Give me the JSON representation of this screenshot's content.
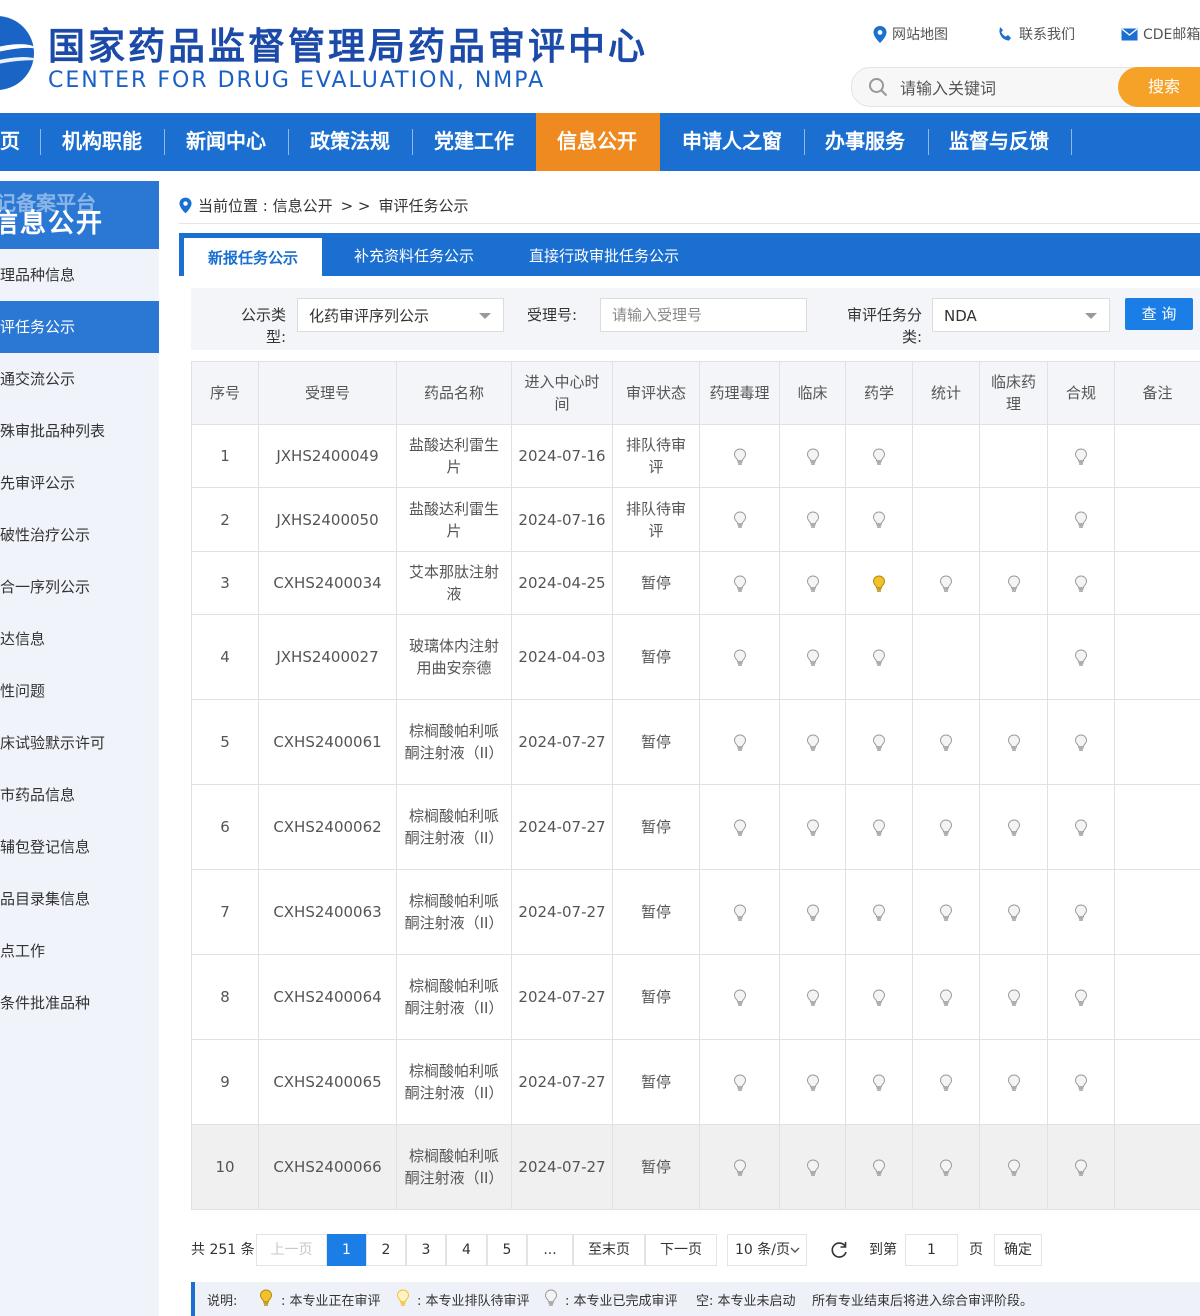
{
  "header": {
    "title_cn": "国家药品监督管理局药品审评中心",
    "title_en": "CENTER FOR DRUG EVALUATION, NMPA",
    "links": [
      "网站地图",
      "联系我们",
      "CDE邮箱"
    ],
    "search_placeholder": "请输入关键词",
    "search_button": "搜索"
  },
  "nav": {
    "items": [
      "页",
      "机构职能",
      "新闻中心",
      "政策法规",
      "党建工作",
      "信息公开",
      "申请人之窗",
      "办事服务",
      "监督与反馈"
    ],
    "active": "信息公开"
  },
  "sidebar": {
    "ghost_title": "记备案平台",
    "title": "信息公开",
    "items": [
      "理品种信息",
      "评任务公示",
      "通交流公示",
      "殊审批品种列表",
      "先审评公示",
      "破性治疗公示",
      "合一序列公示",
      "达信息",
      "性问题",
      "床试验默示许可",
      "市药品信息",
      "辅包登记信息",
      "品目录集信息",
      "点工作",
      "条件批准品种"
    ],
    "active_index": 1
  },
  "breadcrumb": {
    "prefix": "当前位置 : 信息公开",
    "sep": "> >",
    "current": "审评任务公示"
  },
  "tabs": [
    "新报任务公示",
    "补充资料任务公示",
    "直接行政审批任务公示"
  ],
  "filters": {
    "type_label_1": "公示类",
    "type_label_2": "型:",
    "type_value": "化药审评序列公示",
    "accept_label": "受理号:",
    "accept_placeholder": "请输入受理号",
    "task_label_1": "审评任务分",
    "task_label_2": "类:",
    "task_value": "NDA",
    "query_button": "查 询"
  },
  "table": {
    "headers": [
      "序号",
      "受理号",
      "药品名称",
      "进入中心时间",
      "审评状态",
      "药理毒理",
      "临床",
      "药学",
      "统计",
      "临床药理",
      "合规",
      "备注"
    ],
    "rows": [
      {
        "no": "1",
        "id": "JXHS2400049",
        "name": "盐酸达利雷生片",
        "date": "2024-07-16",
        "status": "排队待审评",
        "lamps": [
          "off",
          "off",
          "off",
          "",
          "",
          "off"
        ]
      },
      {
        "no": "2",
        "id": "JXHS2400050",
        "name": "盐酸达利雷生片",
        "date": "2024-07-16",
        "status": "排队待审评",
        "lamps": [
          "off",
          "off",
          "off",
          "",
          "",
          "off"
        ]
      },
      {
        "no": "3",
        "id": "CXHS2400034",
        "name": "艾本那肽注射液",
        "date": "2024-04-25",
        "status": "暂停",
        "lamps": [
          "off",
          "off",
          "on",
          "off",
          "off",
          "off"
        ]
      },
      {
        "no": "4",
        "id": "JXHS2400027",
        "name": "玻璃体内注射用曲安奈德",
        "date": "2024-04-03",
        "status": "暂停",
        "lamps": [
          "off",
          "off",
          "off",
          "",
          "",
          "off"
        ]
      },
      {
        "no": "5",
        "id": "CXHS2400061",
        "name": "棕榈酸帕利哌酮注射液（II）",
        "date": "2024-07-27",
        "status": "暂停",
        "lamps": [
          "off",
          "off",
          "off",
          "off",
          "off",
          "off"
        ]
      },
      {
        "no": "6",
        "id": "CXHS2400062",
        "name": "棕榈酸帕利哌酮注射液（II）",
        "date": "2024-07-27",
        "status": "暂停",
        "lamps": [
          "off",
          "off",
          "off",
          "off",
          "off",
          "off"
        ]
      },
      {
        "no": "7",
        "id": "CXHS2400063",
        "name": "棕榈酸帕利哌酮注射液（II）",
        "date": "2024-07-27",
        "status": "暂停",
        "lamps": [
          "off",
          "off",
          "off",
          "off",
          "off",
          "off"
        ]
      },
      {
        "no": "8",
        "id": "CXHS2400064",
        "name": "棕榈酸帕利哌酮注射液（II）",
        "date": "2024-07-27",
        "status": "暂停",
        "lamps": [
          "off",
          "off",
          "off",
          "off",
          "off",
          "off"
        ]
      },
      {
        "no": "9",
        "id": "CXHS2400065",
        "name": "棕榈酸帕利哌酮注射液（II）",
        "date": "2024-07-27",
        "status": "暂停",
        "lamps": [
          "off",
          "off",
          "off",
          "off",
          "off",
          "off"
        ]
      },
      {
        "no": "10",
        "id": "CXHS2400066",
        "name": "棕榈酸帕利哌酮注射液（II）",
        "date": "2024-07-27",
        "status": "暂停",
        "lamps": [
          "off",
          "off",
          "off",
          "off",
          "off",
          "off"
        ]
      }
    ]
  },
  "pagination": {
    "total": "共 251 条",
    "prev": "上一页",
    "pages": [
      "1",
      "2",
      "3",
      "4",
      "5",
      "..."
    ],
    "current": "1",
    "last": "至末页",
    "next": "下一页",
    "page_size": "10 条/页",
    "goto_label": "到第",
    "goto_value": "1",
    "page_unit": "页",
    "confirm": "确定"
  },
  "legend": {
    "label": "说明:",
    "reviewing": ": 本专业正在审评",
    "queued": ": 本专业排队待审评",
    "done": ": 本专业已完成审评",
    "empty": "空: 本专业未启动",
    "note": "所有专业结束后将进入综合审评阶段。"
  },
  "colors": {
    "primary": "#1a6fd1",
    "accent": "#ef8a20",
    "search_button": "#f6a128",
    "lamp_on": "#f2c12e",
    "lamp_queued": "#f2c12e",
    "lamp_off": "#c9c9c9"
  }
}
